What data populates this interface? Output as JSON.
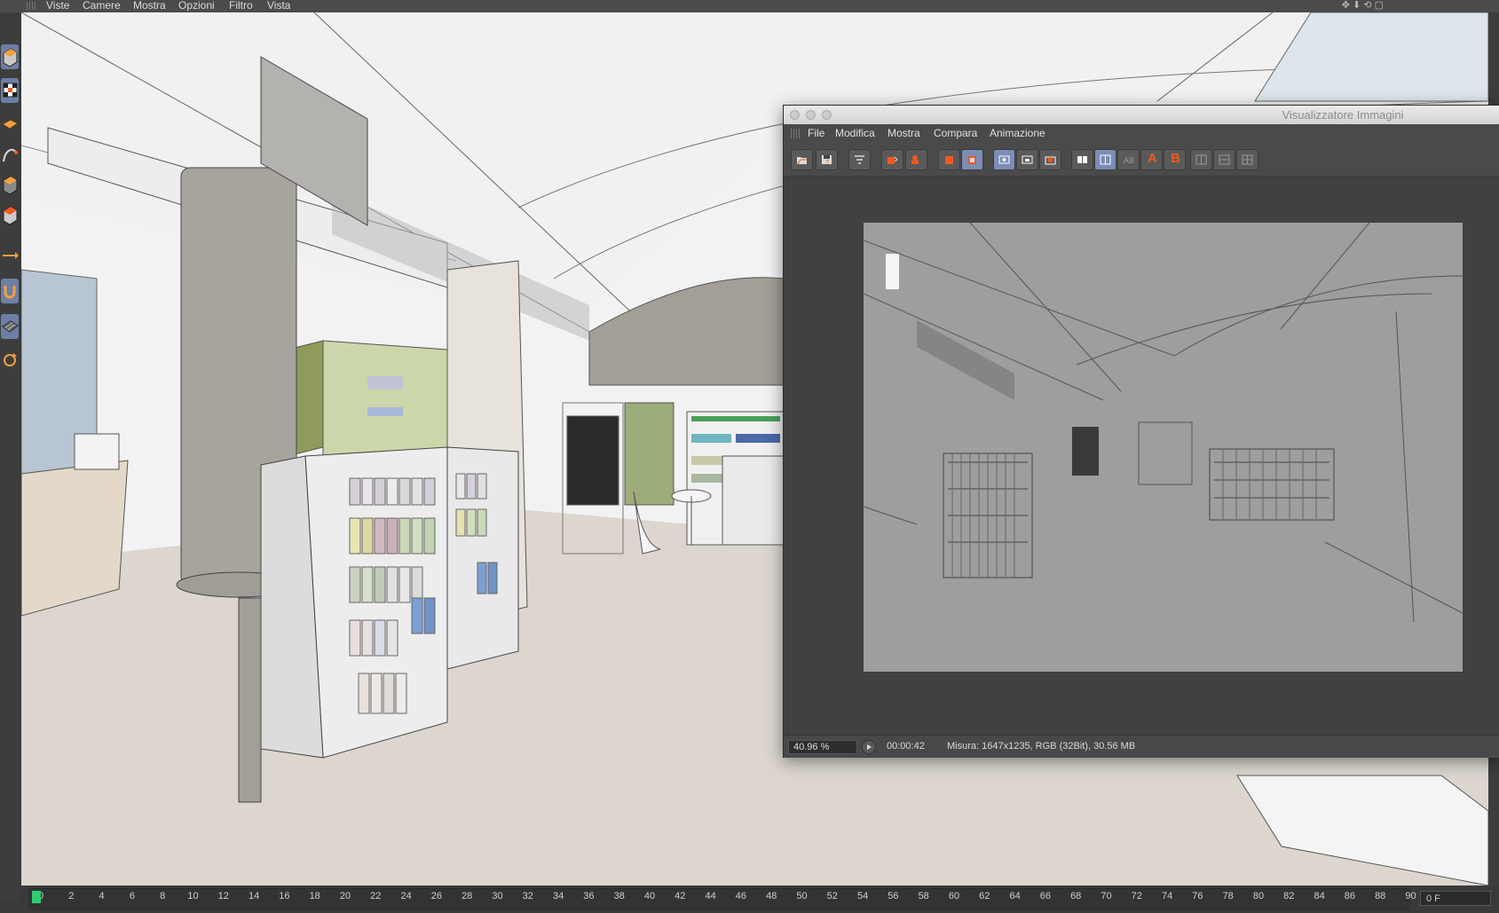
{
  "main_menu": {
    "items": [
      "Viste",
      "Camere",
      "Mostra",
      "Opzioni",
      "Filtro",
      "Vista"
    ]
  },
  "left_tools": [
    "cube-tool-icon",
    "checker-tool-icon",
    "grid-tool-icon",
    "spline-tool-icon",
    "extrude-tool-icon",
    "box-tool-icon",
    "arrow-tool-icon",
    "magnet-tool-icon",
    "plane-tool-icon",
    "rotate-tool-icon"
  ],
  "viewer": {
    "title": "Visualizzatore Immagini",
    "menu": [
      "File",
      "Modifica",
      "Mostra",
      "Compara",
      "Animazione"
    ],
    "toolbar_letters": {
      "a": "A",
      "b": "B"
    },
    "status": {
      "zoom": "40.96 %",
      "time": "00:00:42",
      "info": "Misura: 1647x1235, RGB (32Bit), 30.56 MB"
    }
  },
  "timeline": {
    "ticks": [
      "0",
      "2",
      "4",
      "6",
      "8",
      "10",
      "12",
      "14",
      "16",
      "18",
      "20",
      "22",
      "24",
      "26",
      "28",
      "30",
      "32",
      "34",
      "36",
      "38",
      "40",
      "42",
      "44",
      "46",
      "48",
      "50",
      "52",
      "54",
      "56",
      "58",
      "60",
      "62",
      "64",
      "66",
      "68",
      "70",
      "72",
      "74",
      "76",
      "78",
      "80",
      "82",
      "84",
      "86",
      "88",
      "90"
    ],
    "frame_value": "0 F"
  },
  "colors": {
    "accent": "#f05a1e",
    "active": "#7a8db5",
    "playhead": "#2ecc71"
  }
}
